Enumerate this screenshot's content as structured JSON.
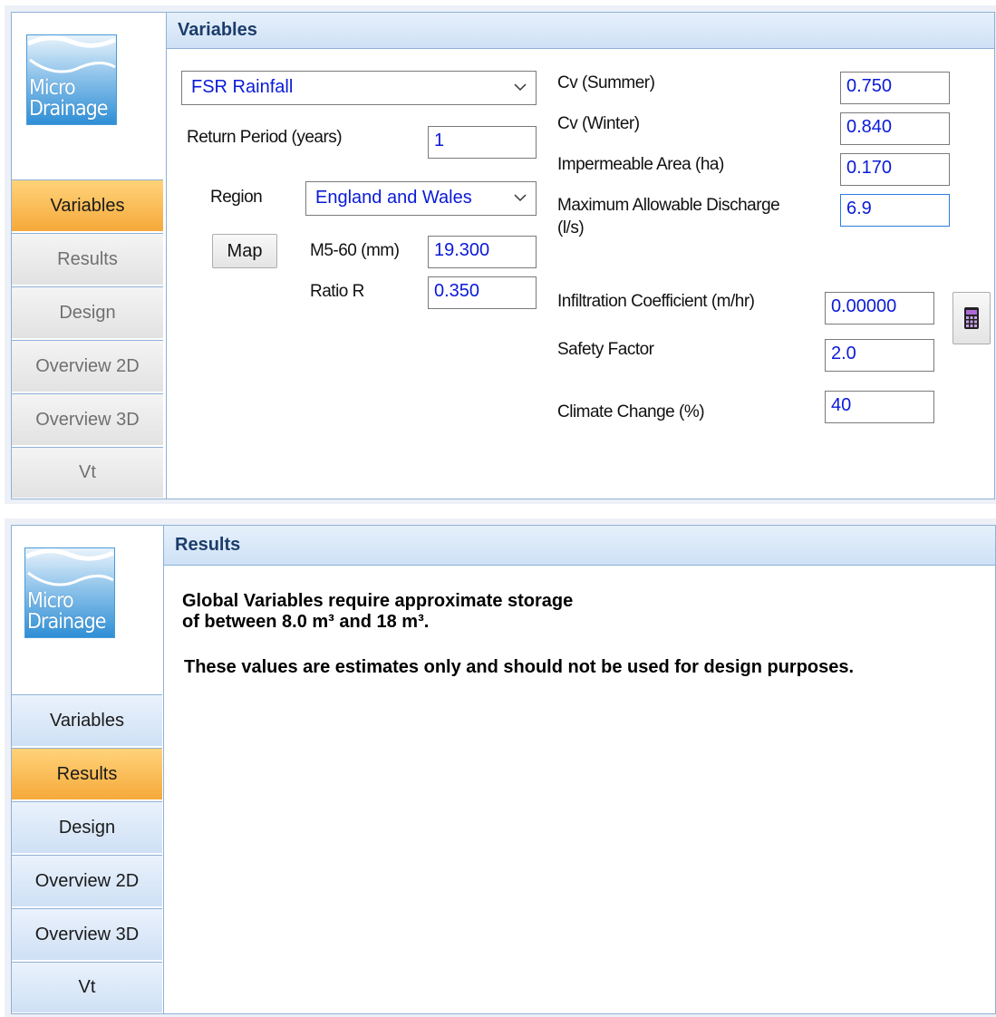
{
  "logo": {
    "line1": "Micro",
    "line2": "Drainage"
  },
  "panel1": {
    "header": "Variables",
    "nav": [
      "Variables",
      "Results",
      "Design",
      "Overview 2D",
      "Overview 3D",
      "Vt"
    ],
    "rainfall_select": "FSR Rainfall",
    "return_period_label": "Return Period (years)",
    "return_period_value": "1",
    "region_label": "Region",
    "region_select": "England and Wales",
    "map_button": "Map",
    "m560_label": "M5-60 (mm)",
    "m560_value": "19.300",
    "ratio_label": "Ratio R",
    "ratio_value": "0.350",
    "cv_summer_label": "Cv (Summer)",
    "cv_summer_value": "0.750",
    "cv_winter_label": "Cv (Winter)",
    "cv_winter_value": "0.840",
    "imp_area_label": "Impermeable Area (ha)",
    "imp_area_value": "0.170",
    "max_discharge_label_1": "Maximum Allowable Discharge",
    "max_discharge_label_2": "(l/s)",
    "max_discharge_value": "6.9",
    "infiltration_label": "Infiltration Coefficient (m/hr)",
    "infiltration_value": "0.00000",
    "safety_label": "Safety Factor",
    "safety_value": "2.0",
    "climate_label": "Climate Change (%)",
    "climate_value": "40"
  },
  "panel2": {
    "header": "Results",
    "nav": [
      "Variables",
      "Results",
      "Design",
      "Overview 2D",
      "Overview 3D",
      "Vt"
    ],
    "message_line1": "Global Variables require approximate storage",
    "message_line2": "of between 8.0 m³ and 18 m³.",
    "message_line3": "These values are estimates only and should not be used for design purposes."
  },
  "colors": {
    "active_tab": "#f6a93a",
    "input_text": "#0a1ad8",
    "header_text": "#1c3d6b"
  }
}
